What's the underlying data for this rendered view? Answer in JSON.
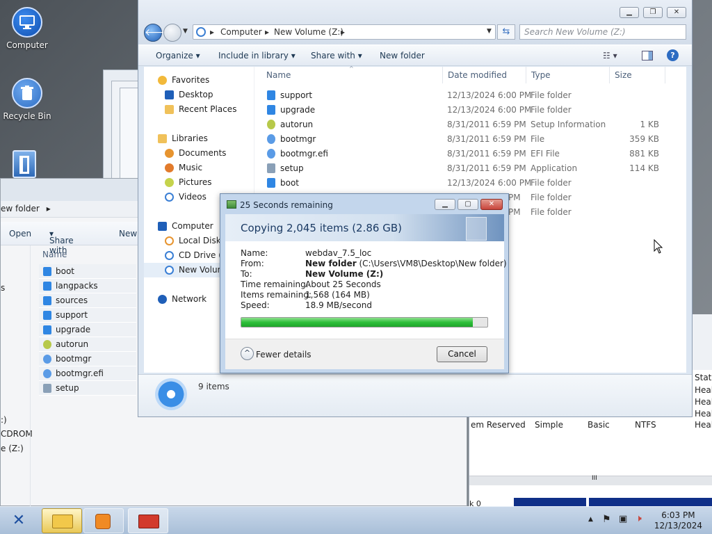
{
  "desktop": {
    "icons": [
      {
        "label": "Computer"
      },
      {
        "label": "Recycle Bin"
      }
    ]
  },
  "back_window": {
    "address": "ew folder",
    "toolbar": {
      "open": "Open",
      "share_with": "Share with",
      "new": "New"
    },
    "column_name": "Name",
    "files": [
      {
        "name": "boot",
        "kind": "folder"
      },
      {
        "name": "langpacks",
        "kind": "folder"
      },
      {
        "name": "sources",
        "kind": "folder"
      },
      {
        "name": "support",
        "kind": "folder"
      },
      {
        "name": "upgrade",
        "kind": "folder"
      },
      {
        "name": "autorun",
        "kind": "setup"
      },
      {
        "name": "bootmgr",
        "kind": "file"
      },
      {
        "name": "bootmgr.efi",
        "kind": "file"
      },
      {
        "name": "setup",
        "kind": "app"
      }
    ],
    "left_labels": [
      "s",
      ":)",
      "CDROM",
      "e (Z:)"
    ]
  },
  "explorer": {
    "breadcrumb": [
      "Computer",
      "New Volume (Z:)"
    ],
    "search_placeholder": "Search New Volume (Z:)",
    "commands": {
      "organize": "Organize",
      "include_in_library": "Include in library",
      "share_with": "Share with",
      "new_folder": "New folder"
    },
    "nav": {
      "favorites": "Favorites",
      "desktop": "Desktop",
      "recent_places": "Recent Places",
      "libraries": "Libraries",
      "documents": "Documents",
      "music": "Music",
      "pictures": "Pictures",
      "videos": "Videos",
      "computer": "Computer",
      "local_disk": "Local Disk (C",
      "cd_drive": "CD Drive (D",
      "new_volume": "New Volum",
      "network": "Network"
    },
    "columns": {
      "name": "Name",
      "date": "Date modified",
      "type": "Type",
      "size": "Size"
    },
    "files": [
      {
        "name": "support",
        "date": "12/13/2024 6:00 PM",
        "type": "File folder",
        "size": "",
        "kind": "folder"
      },
      {
        "name": "upgrade",
        "date": "12/13/2024 6:00 PM",
        "type": "File folder",
        "size": "",
        "kind": "folder"
      },
      {
        "name": "autorun",
        "date": "8/31/2011 6:59 PM",
        "type": "Setup Information",
        "size": "1 KB",
        "kind": "setup"
      },
      {
        "name": "bootmgr",
        "date": "8/31/2011 6:59 PM",
        "type": "File",
        "size": "359 KB",
        "kind": "file"
      },
      {
        "name": "bootmgr.efi",
        "date": "8/31/2011 6:59 PM",
        "type": "EFI File",
        "size": "881 KB",
        "kind": "file"
      },
      {
        "name": "setup",
        "date": "8/31/2011 6:59 PM",
        "type": "Application",
        "size": "114 KB",
        "kind": "app"
      },
      {
        "name": "boot",
        "date": "12/13/2024 6:00 PM",
        "type": "File folder",
        "size": "",
        "kind": "folder"
      },
      {
        "name": "",
        "date": "PM",
        "type": "File folder",
        "size": "",
        "kind": "hidden"
      },
      {
        "name": "",
        "date": "PM",
        "type": "File folder",
        "size": "",
        "kind": "hidden"
      }
    ],
    "item_count": "9 items"
  },
  "copy_dialog": {
    "title": "25 Seconds remaining",
    "heading": "Copying 2,045 items (2.86 GB)",
    "name_label": "Name:",
    "name_value": "webdav_7.5_loc",
    "from_label": "From:",
    "from_folder": "New folder",
    "from_path": "(C:\\Users\\VM8\\Desktop\\New folder)",
    "to_label": "To:",
    "to_value": "New Volume (Z:)",
    "time_label": "Time remaining:",
    "time_value": "About 25 Seconds",
    "items_label": "Items remaining:",
    "items_value": "1,568 (164 MB)",
    "speed_label": "Speed:",
    "speed_value": "18.9 MB/second",
    "progress_percent": 94,
    "fewer_details": "Fewer details",
    "cancel": "Cancel"
  },
  "disk_mgmt": {
    "status_header": "Status",
    "health_values": [
      "Heal",
      "Heal",
      "Heal"
    ],
    "row": {
      "name": "em Reserved",
      "layout": "Simple",
      "type": "Basic",
      "fs": "NTFS",
      "status": "Heal"
    },
    "scroll_mark": "III",
    "bottom_label": "k 0"
  },
  "tray": {
    "time": "6:03 PM",
    "date": "12/13/2024"
  },
  "colors": {
    "accent": "#1f5fb8",
    "progress": "#2fbf3a",
    "close_red": "#c8453b"
  }
}
